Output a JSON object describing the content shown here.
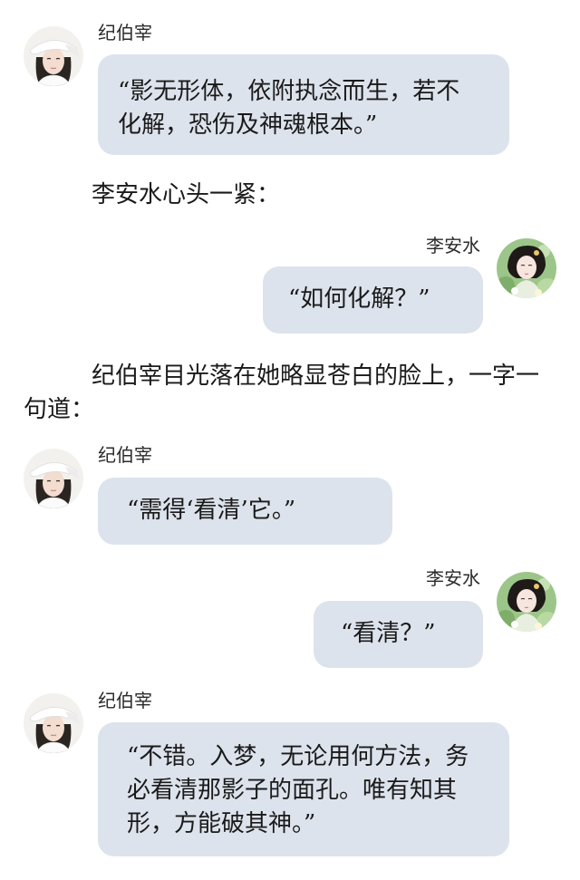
{
  "speakers": {
    "male": "纪伯宰",
    "female": "李安水"
  },
  "messages": [
    {
      "speaker": "纪伯宰",
      "text": "“影无形体，依附执念而生，若不\n化解，恐伤及神魂根本。”"
    },
    {
      "speaker": "李安水",
      "text": "“如何化解？”"
    },
    {
      "speaker": "纪伯宰",
      "text": "“需得‘看清’它。”"
    },
    {
      "speaker": "李安水",
      "text": "“看清？”"
    },
    {
      "speaker": "纪伯宰",
      "text": "“不错。入梦，无论用何方法，务\n必看清那影子的面孔。唯有知其\n形，方能破其神。”"
    }
  ],
  "narration": [
    "李安水心头一紧：",
    "纪伯宰目光落在她略显苍白的脸上，一字一句道："
  ],
  "colors": {
    "bubble": "#dde3ec",
    "text": "#1a1a1a",
    "background": "#ffffff"
  },
  "icons": {
    "male_avatar": "avatar-white-hat-man",
    "female_avatar": "avatar-woman-flowers"
  }
}
